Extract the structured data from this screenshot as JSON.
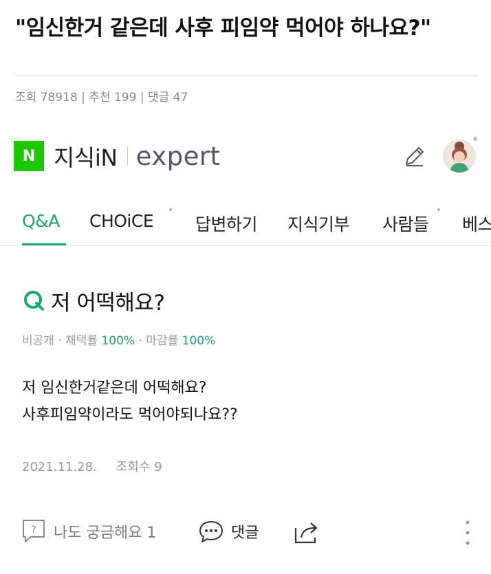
{
  "post": {
    "title": "\"임신한거 같은데 사후 피임약 먹어야 하나요?\"",
    "meta": {
      "views_label": "조회 78918",
      "sep1": " | ",
      "likes_label": "추천 199",
      "sep2": " | ",
      "comments_label": "댓글 47"
    }
  },
  "app": {
    "logo_letter": "N",
    "brand": "지식iN",
    "expert": "expert",
    "colors": {
      "accent": "#1aa86a",
      "naver_green": "#1ec800"
    }
  },
  "tabs": [
    {
      "label": "Q&A",
      "active": true
    },
    {
      "label": "CHOiCE",
      "active": false
    },
    {
      "label": "답변하기",
      "active": false
    },
    {
      "label": "지식기부",
      "active": false
    },
    {
      "label": "사람들",
      "active": false
    },
    {
      "label": "베스",
      "active": false
    }
  ],
  "question": {
    "title": "저 어떡해요?",
    "stats": {
      "private": "비공개",
      "dot": " · ",
      "adopt_label": "채택률 ",
      "adopt_value": "100%",
      "close_label": "마감률 ",
      "close_value": "100%"
    },
    "body": [
      "저 임신한거같은데 어떡해요?",
      "사후피임약이라도 먹어야되나요??"
    ],
    "date": "2021.11.28.",
    "views": "조회수 9"
  },
  "actions": {
    "curious_label": "나도 궁금해요 1",
    "comment_label": "댓글",
    "icons": [
      "question-box-icon",
      "speech-bubble-icon",
      "share-icon",
      "more-vertical-icon",
      "pencil-icon"
    ]
  }
}
